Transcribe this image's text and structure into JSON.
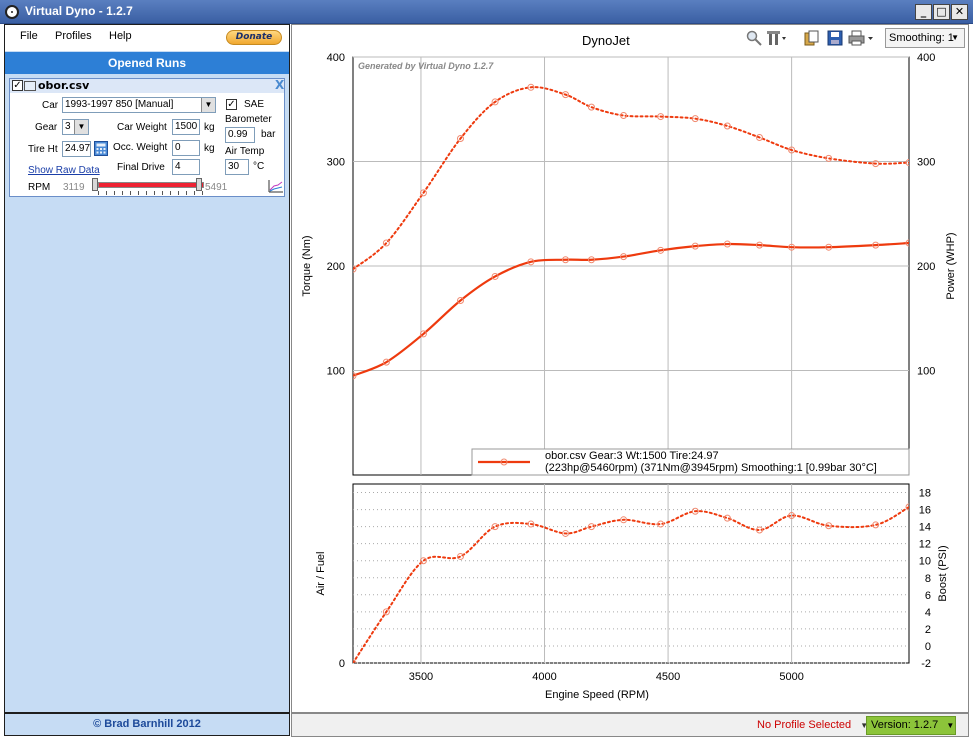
{
  "window": {
    "title": "Virtual Dyno - 1.2.7",
    "min": "_",
    "max": "□",
    "close": "✕"
  },
  "menu": {
    "file": "File",
    "profiles": "Profiles",
    "help": "Help",
    "donate": "Donate"
  },
  "left": {
    "opened_runs": "Opened Runs",
    "run": {
      "filename": "obor.csv",
      "close": "X",
      "car_label": "Car",
      "car_value": "1993-1997 850  [Manual]",
      "sae_label": "SAE",
      "sae_checked": "✓",
      "gear_label": "Gear",
      "gear_value": "3",
      "car_weight_label": "Car Weight",
      "car_weight_value": "1500",
      "car_weight_unit": "kg",
      "barometer_label": "Barometer",
      "barometer_value": "0.99",
      "barometer_unit": "bar",
      "tire_label": "Tire Ht",
      "tire_value": "24.97",
      "occ_weight_label": "Occ. Weight",
      "occ_weight_value": "0",
      "occ_weight_unit": "kg",
      "air_temp_label": "Air Temp",
      "air_temp_value": "30",
      "air_temp_unit": "°C",
      "final_drive_label": "Final Drive",
      "final_drive_value": "4",
      "raw_data_link": "Show Raw Data",
      "rpm_label": "RPM",
      "rpm_min": "3119",
      "rpm_max": "5491"
    },
    "copyright": "© Brad Barnhill 2012"
  },
  "toolbar": {
    "smoothing": "Smoothing: 1",
    "chart_title": "DynoJet",
    "icons": [
      "zoom-icon",
      "tools-icon",
      "copy-icon",
      "save-icon",
      "print-icon"
    ]
  },
  "status": {
    "profile": "No Profile Selected",
    "version": "Version: 1.2.7"
  },
  "chart_data": [
    {
      "type": "line",
      "title": "DynoJet",
      "watermark": "Generated by Virtual Dyno 1.2.7",
      "xlabel": "Engine Speed (RPM)",
      "ylabel_left": "Torque (Nm)",
      "ylabel_right": "Power (WHP)",
      "xlim": [
        3225,
        5475
      ],
      "ylim": [
        0,
        400
      ],
      "xticks": [
        3500,
        4000,
        4500,
        5000
      ],
      "yticks": [
        100,
        200,
        300,
        400
      ],
      "legend": {
        "line1": "obor.csv Gear:3 Wt:1500 Tire:24.97",
        "line2": "(223hp@5460rpm) (371Nm@3945rpm) Smoothing:1 [0.99bar 30°C]",
        "placement": "bottom-right"
      },
      "series": [
        {
          "axis": "torque",
          "style": "dotted",
          "x": [
            3225,
            3360,
            3510,
            3660,
            3800,
            3945,
            4085,
            4190,
            4320,
            4470,
            4610,
            4740,
            4870,
            5000,
            5150,
            5340,
            5475
          ],
          "values": [
            197,
            222,
            270,
            322,
            357,
            371,
            364,
            352,
            344,
            343,
            341,
            334,
            323,
            311,
            303,
            298,
            299
          ]
        },
        {
          "axis": "power",
          "style": "solid",
          "x": [
            3225,
            3360,
            3510,
            3660,
            3800,
            3945,
            4085,
            4190,
            4320,
            4470,
            4610,
            4740,
            4870,
            5000,
            5150,
            5340,
            5475
          ],
          "values": [
            95,
            108,
            135,
            167,
            190,
            204,
            206,
            206,
            209,
            215,
            219,
            221,
            220,
            218,
            218,
            220,
            222
          ]
        }
      ]
    },
    {
      "type": "line",
      "xlabel": "Engine Speed (RPM)",
      "ylabel_left": "Air / Fuel",
      "ylabel_right": "Boost (PSI)",
      "xlim": [
        3225,
        5475
      ],
      "ylim_left_tick": "0",
      "ylim": [
        -2,
        19
      ],
      "yticks": [
        -2,
        0,
        2,
        4,
        6,
        8,
        10,
        12,
        14,
        16,
        18
      ],
      "series": [
        {
          "style": "dotted",
          "x": [
            3225,
            3360,
            3510,
            3660,
            3800,
            3945,
            4085,
            4190,
            4320,
            4470,
            4610,
            4740,
            4870,
            5000,
            5150,
            5340,
            5475
          ],
          "values": [
            -2,
            4,
            10,
            10.5,
            14,
            14.3,
            13.2,
            14,
            14.8,
            14.3,
            15.8,
            15,
            13.6,
            15.3,
            14.1,
            14.2,
            16.3
          ]
        }
      ]
    }
  ]
}
